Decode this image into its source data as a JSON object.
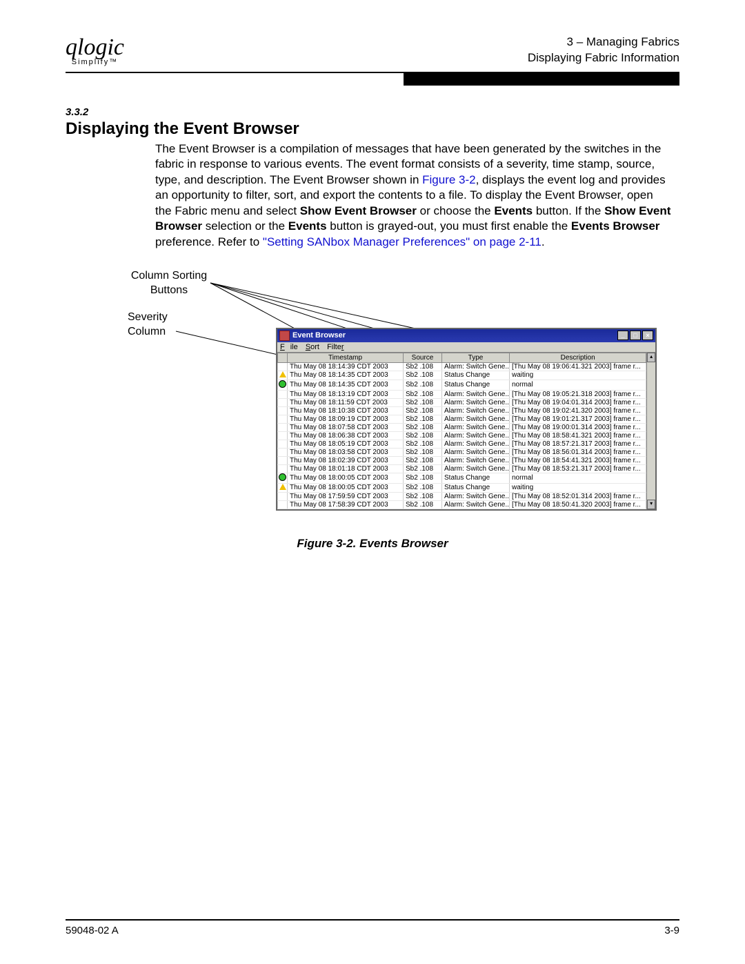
{
  "header": {
    "logo_script": "qlogic",
    "logo_sub": "Simplify™",
    "line1": "3 – Managing Fabrics",
    "line2": "Displaying Fabric Information"
  },
  "section": {
    "number": "3.3.2",
    "title": "Displaying the Event Browser"
  },
  "body": {
    "p1a": "The Event Browser is a compilation of messages that have been generated by the switches in the fabric in response to various events. The event format consists of a severity, time stamp, source, type, and description. The Event Browser shown in ",
    "xref1": "Figure 3-2",
    "p1b": ", displays the event log and provides an opportunity to filter, sort, and export the contents to a file. To display the Event Browser, open the Fabric menu and select ",
    "b1": "Show Event Browser",
    "p1c": " or choose the ",
    "b2": "Events",
    "p1d": " button. If the ",
    "b3": "Show Event Browser",
    "p1e": " selection or the ",
    "b4": "Events",
    "p1f": " button is grayed-out, you must first enable the ",
    "b5": "Events Browser",
    "p1g": " preference. Refer to ",
    "xref2": "\"Setting SANbox Manager Preferences\" on page 2-11",
    "p1h": "."
  },
  "annotations": {
    "sort": "Column Sorting\nButtons",
    "severity": "Severity\nColumn"
  },
  "window": {
    "title": "Event Browser",
    "menus": [
      "File",
      "Sort",
      "Filter"
    ],
    "columns": [
      "",
      "Timestamp",
      "Source",
      "Type",
      "Description"
    ],
    "col_widths": [
      "14px",
      "168px",
      "56px",
      "98px",
      "188px",
      "12px"
    ],
    "rows": [
      {
        "sev": "",
        "ts": "Thu May 08 18:14:39 CDT 2003",
        "src": "Sb2 .108",
        "type": "Alarm: Switch Gene...",
        "desc": "[Thu May 08 19:06:41.321 2003] frame r..."
      },
      {
        "sev": "tri",
        "ts": "Thu May 08 18:14:35 CDT 2003",
        "src": "Sb2 .108",
        "type": "Status Change",
        "desc": "waiting"
      },
      {
        "sev": "dot",
        "ts": "Thu May 08 18:14:35 CDT 2003",
        "src": "Sb2 .108",
        "type": "Status Change",
        "desc": "normal"
      },
      {
        "sev": "",
        "ts": "Thu May 08 18:13:19 CDT 2003",
        "src": "Sb2 .108",
        "type": "Alarm: Switch Gene...",
        "desc": "[Thu May 08 19:05:21.318 2003] frame r..."
      },
      {
        "sev": "",
        "ts": "Thu May 08 18:11:59 CDT 2003",
        "src": "Sb2 .108",
        "type": "Alarm: Switch Gene...",
        "desc": "[Thu May 08 19:04:01.314 2003] frame r..."
      },
      {
        "sev": "",
        "ts": "Thu May 08 18:10:38 CDT 2003",
        "src": "Sb2 .108",
        "type": "Alarm: Switch Gene...",
        "desc": "[Thu May 08 19:02:41.320 2003] frame r..."
      },
      {
        "sev": "",
        "ts": "Thu May 08 18:09:19 CDT 2003",
        "src": "Sb2 .108",
        "type": "Alarm: Switch Gene...",
        "desc": "[Thu May 08 19:01:21.317 2003] frame r..."
      },
      {
        "sev": "",
        "ts": "Thu May 08 18:07:58 CDT 2003",
        "src": "Sb2 .108",
        "type": "Alarm: Switch Gene...",
        "desc": "[Thu May 08 19:00:01.314 2003] frame r..."
      },
      {
        "sev": "",
        "ts": "Thu May 08 18:06:38 CDT 2003",
        "src": "Sb2 .108",
        "type": "Alarm: Switch Gene...",
        "desc": "[Thu May 08 18:58:41.321 2003] frame r..."
      },
      {
        "sev": "",
        "ts": "Thu May 08 18:05:19 CDT 2003",
        "src": "Sb2 .108",
        "type": "Alarm: Switch Gene...",
        "desc": "[Thu May 08 18:57:21.317 2003] frame r..."
      },
      {
        "sev": "",
        "ts": "Thu May 08 18:03:58 CDT 2003",
        "src": "Sb2 .108",
        "type": "Alarm: Switch Gene...",
        "desc": "[Thu May 08 18:56:01.314 2003] frame r..."
      },
      {
        "sev": "",
        "ts": "Thu May 08 18:02:39 CDT 2003",
        "src": "Sb2 .108",
        "type": "Alarm: Switch Gene...",
        "desc": "[Thu May 08 18:54:41.321 2003] frame r..."
      },
      {
        "sev": "",
        "ts": "Thu May 08 18:01:18 CDT 2003",
        "src": "Sb2 .108",
        "type": "Alarm: Switch Gene...",
        "desc": "[Thu May 08 18:53:21.317 2003] frame r..."
      },
      {
        "sev": "dot",
        "ts": "Thu May 08 18:00:05 CDT 2003",
        "src": "Sb2 .108",
        "type": "Status Change",
        "desc": "normal"
      },
      {
        "sev": "tri",
        "ts": "Thu May 08 18:00:05 CDT 2003",
        "src": "Sb2 .108",
        "type": "Status Change",
        "desc": "waiting"
      },
      {
        "sev": "",
        "ts": "Thu May 08 17:59:59 CDT 2003",
        "src": "Sb2 .108",
        "type": "Alarm: Switch Gene...",
        "desc": "[Thu May 08 18:52:01.314 2003] frame r..."
      },
      {
        "sev": "",
        "ts": "Thu May 08 17:58:39 CDT 2003",
        "src": "Sb2 .108",
        "type": "Alarm: Switch Gene...",
        "desc": "[Thu May 08 18:50:41.320 2003] frame r..."
      }
    ]
  },
  "figure_caption": "Figure 3-2.  Events Browser",
  "footer": {
    "left": "59048-02  A",
    "right": "3-9"
  }
}
